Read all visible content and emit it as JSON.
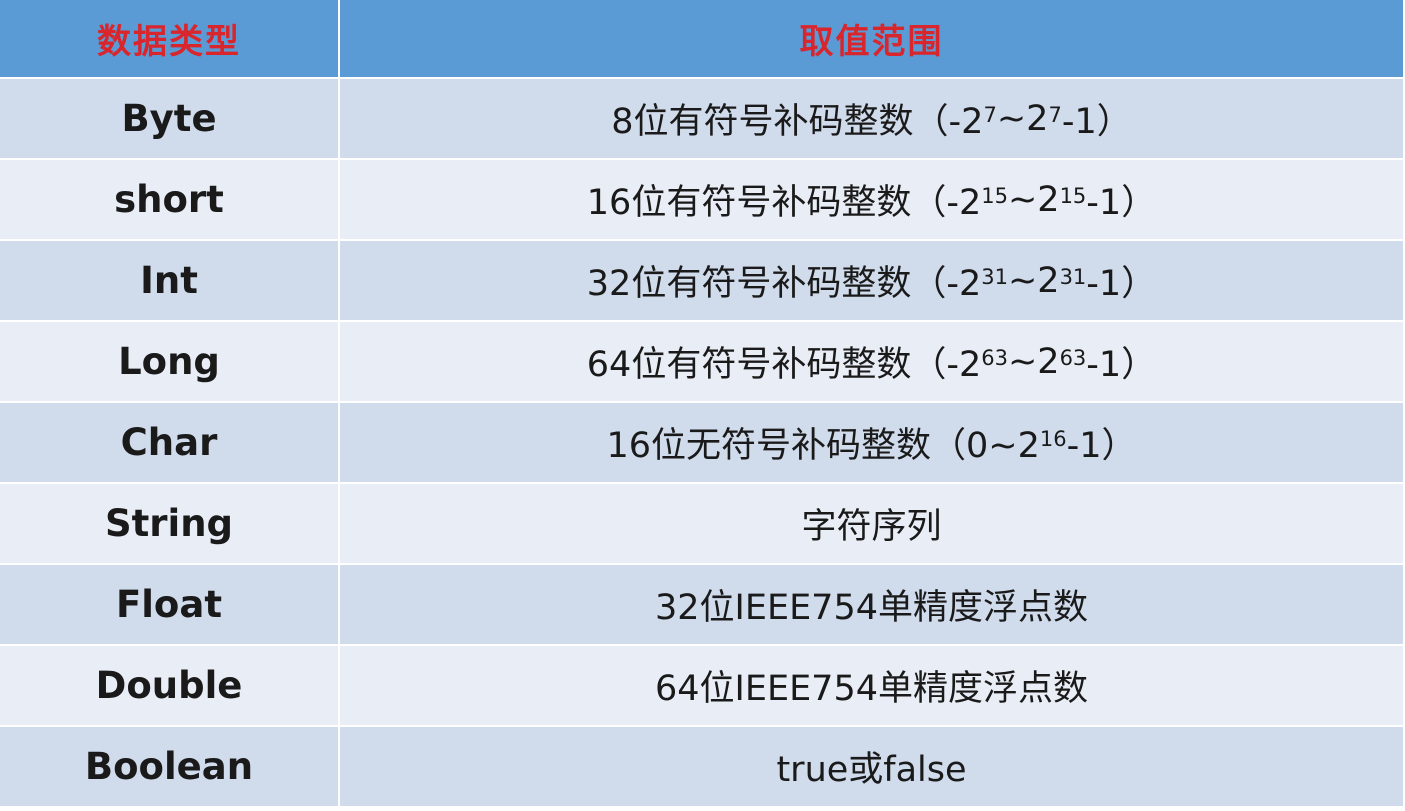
{
  "header": {
    "type_col": "数据类型",
    "range_col": "取值范围"
  },
  "rows": [
    {
      "type": "Byte",
      "pre": "8位有符号补码整数（-2",
      "exp1": "7",
      "mid": "~2",
      "exp2": "7",
      "post": "-1）"
    },
    {
      "type": "short",
      "pre": "16位有符号补码整数（-2",
      "exp1": "15",
      "mid": "~2",
      "exp2": "15",
      "post": "-1）"
    },
    {
      "type": "Int",
      "pre": "32位有符号补码整数（-2",
      "exp1": "31",
      "mid": "~2",
      "exp2": "31",
      "post": "-1）"
    },
    {
      "type": "Long",
      "pre": "64位有符号补码整数（-2",
      "exp1": "63",
      "mid": "~2",
      "exp2": "63",
      "post": "-1）"
    },
    {
      "type": "Char",
      "pre": "16位无符号补码整数（0~2",
      "exp1": "16",
      "mid": "",
      "exp2": "",
      "post": "-1）"
    },
    {
      "type": "String",
      "text": "字符序列"
    },
    {
      "type": "Float",
      "text": "32位IEEE754单精度浮点数"
    },
    {
      "type": "Double",
      "text": "64位IEEE754单精度浮点数"
    },
    {
      "type": "Boolean",
      "text": "true或false"
    }
  ],
  "colors": {
    "header_bg": "#5b9bd5",
    "header_text": "#d9262c",
    "row_dark": "#d0dbec",
    "row_light": "#e9eef6"
  }
}
